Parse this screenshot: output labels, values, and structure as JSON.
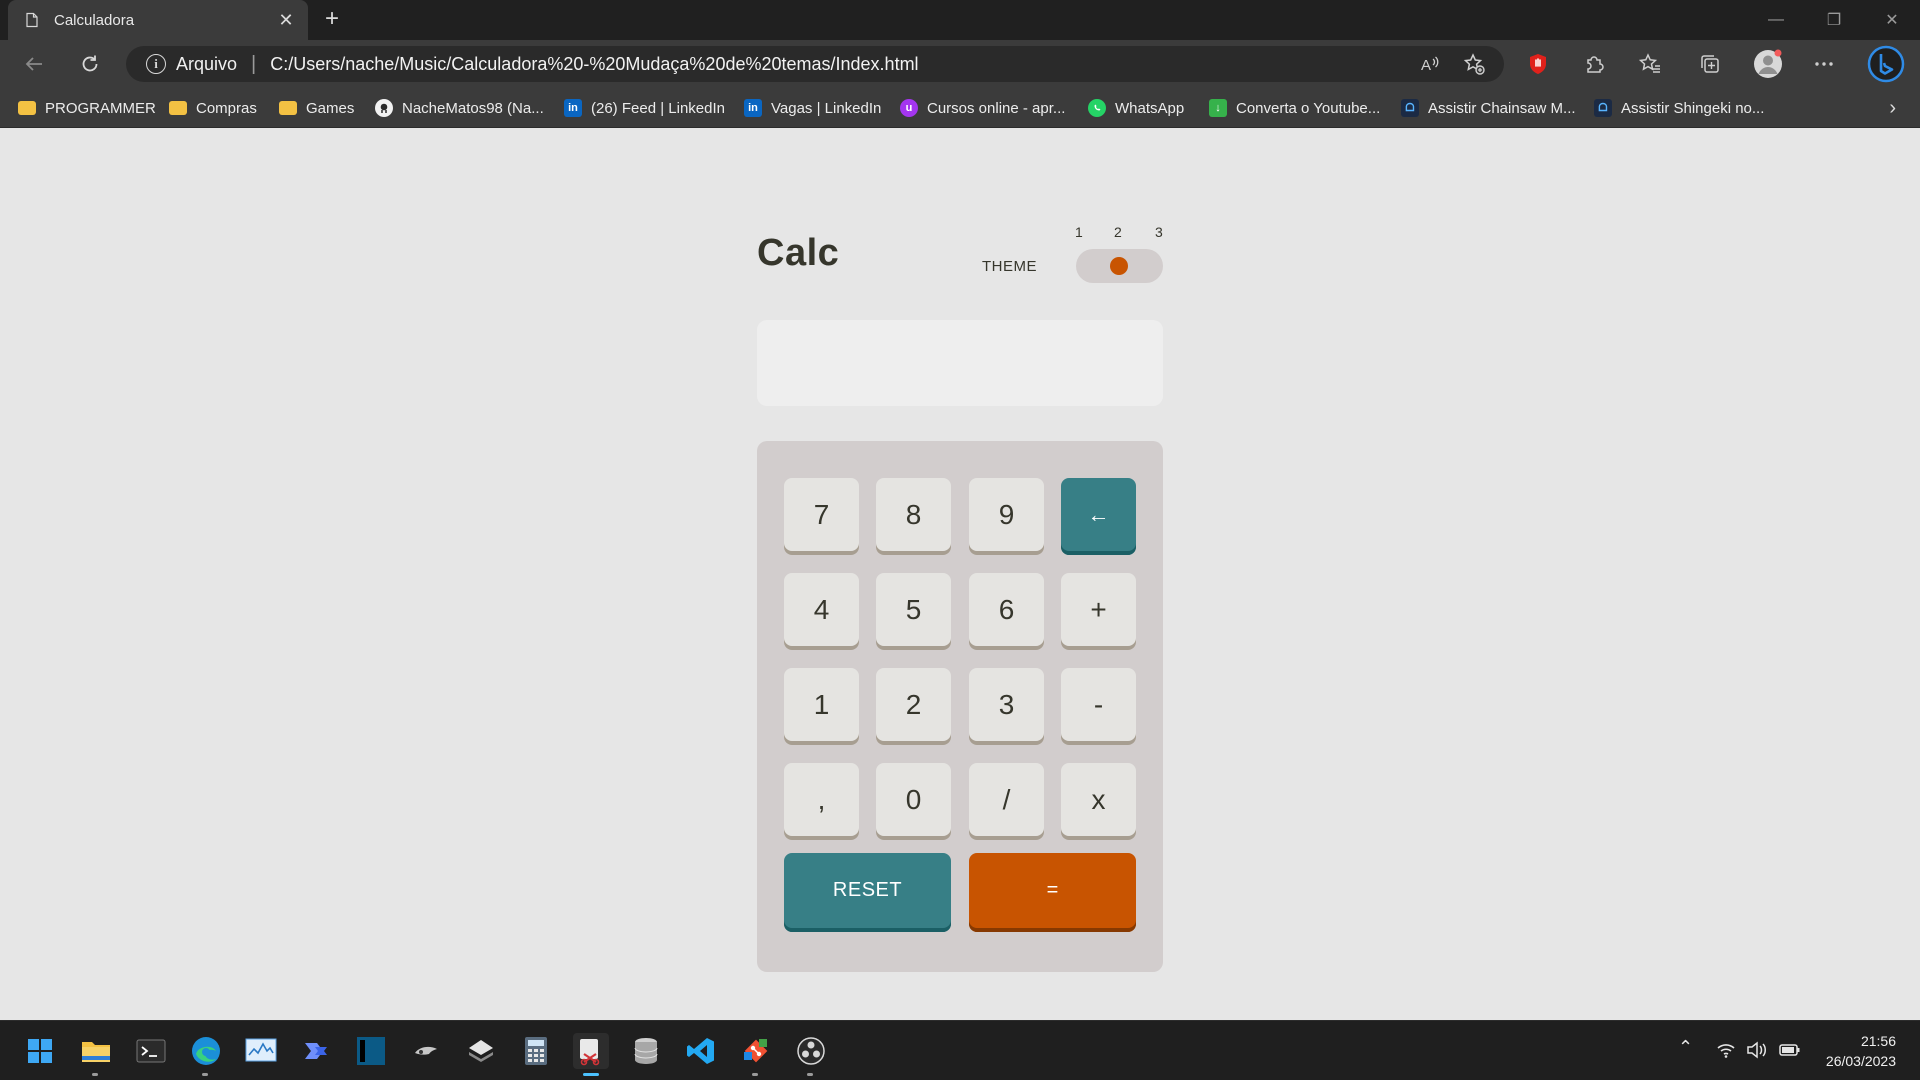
{
  "browser": {
    "tab_title": "Calculadora",
    "address_prefix": "Arquivo",
    "address_separator": "|",
    "url": "C:/Users/nache/Music/Calculadora%20-%20Mudaça%20de%20temas/Index.html",
    "bookmarks": [
      {
        "label": "PROGRAMMER",
        "icon": "folder-icon"
      },
      {
        "label": "Compras",
        "icon": "folder-icon"
      },
      {
        "label": "Games",
        "icon": "folder-icon"
      },
      {
        "label": "NacheMatos98 (Na...",
        "icon": "github-icon"
      },
      {
        "label": "(26) Feed | LinkedIn",
        "icon": "linkedin-icon"
      },
      {
        "label": "Vagas | LinkedIn",
        "icon": "linkedin-icon"
      },
      {
        "label": "Cursos online - apr...",
        "icon": "udemy-icon"
      },
      {
        "label": "WhatsApp",
        "icon": "whatsapp-icon"
      },
      {
        "label": "Converta o Youtube...",
        "icon": "download-icon"
      },
      {
        "label": "Assistir Chainsaw M...",
        "icon": "anime-site-icon"
      },
      {
        "label": "Assistir Shingeki no...",
        "icon": "anime-site-icon"
      }
    ]
  },
  "app": {
    "title": "Calc",
    "theme_label": "THEME",
    "theme_numbers": [
      "1",
      "2",
      "3"
    ],
    "active_theme": 2,
    "display_value": "",
    "keys": {
      "k7": "7",
      "k8": "8",
      "k9": "9",
      "back": "←",
      "k4": "4",
      "k5": "5",
      "k6": "6",
      "plus": "+",
      "k1": "1",
      "k2": "2",
      "k3": "3",
      "minus": "-",
      "comma": ",",
      "k0": "0",
      "divide": "/",
      "multiply": "x",
      "reset": "RESET",
      "equals": "="
    },
    "colors": {
      "background": "#e6e6e6",
      "keypad": "#d2cdcd",
      "key": "#e5e4e1",
      "accent_teal": "#377f86",
      "accent_orange": "#c85401",
      "text": "#36362c"
    }
  },
  "taskbar": {
    "time": "21:56",
    "date": "26/03/2023"
  }
}
